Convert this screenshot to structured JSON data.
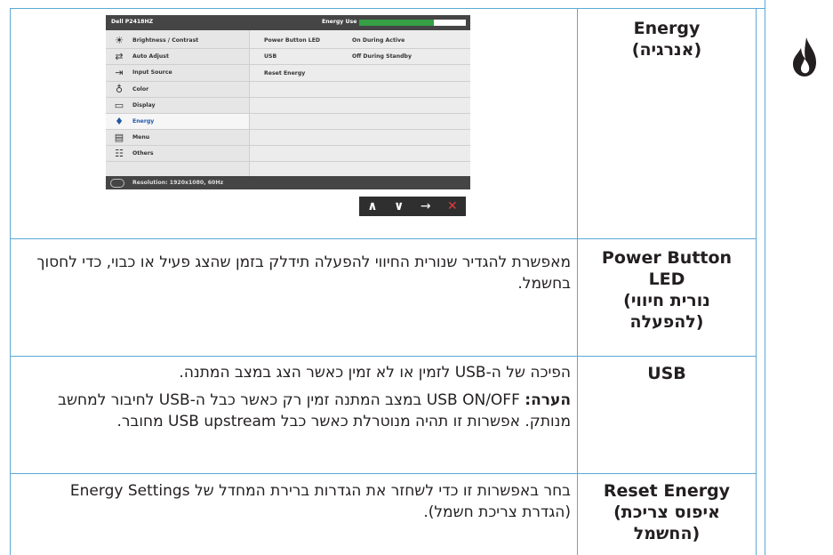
{
  "osd": {
    "model": "Dell P2418HZ",
    "energy_use_label": "Energy Use",
    "energy_use_level": 0.7,
    "menu": [
      {
        "label": "Brightness / Contrast",
        "icon": "brightness-icon"
      },
      {
        "label": "Auto Adjust",
        "icon": "auto-adjust-icon"
      },
      {
        "label": "Input Source",
        "icon": "input-source-icon"
      },
      {
        "label": "Color",
        "icon": "color-icon"
      },
      {
        "label": "Display",
        "icon": "display-icon"
      },
      {
        "label": "Energy",
        "icon": "energy-icon"
      },
      {
        "label": "Menu",
        "icon": "menu-icon"
      },
      {
        "label": "Others",
        "icon": "others-icon"
      }
    ],
    "settings": [
      {
        "name": "Power Button LED",
        "value": "On During Active"
      },
      {
        "name": "USB",
        "value": "Off During Standby"
      },
      {
        "name": "Reset Energy",
        "value": ""
      }
    ],
    "resolution": "Resolution: 1920x1080, 60Hz",
    "buttons": [
      "∧",
      "∨",
      "→",
      "✕"
    ]
  },
  "rows": [
    {
      "title": "Energy\n(אנרגיה)"
    },
    {
      "title": "Power Button\nLED\n(נורית חיווי\nלהפעלה)",
      "desc": [
        "מאפשרת להגדיר שנורית החיווי להפעלה תידלק בזמן שהצג פעיל או כבוי, כדי לחסוך בחשמל."
      ]
    },
    {
      "title": "USB",
      "desc_line1": "הפיכה של ה-USB לזמין או לא זמין כאשר הצג במצב המתנה.",
      "note_label": "הערה:",
      "note_text": " USB ON/OFF במצב המתנה זמין רק כאשר כבל ה-USB לחיבור למחשב מנותק. אפשרות זו תהיה מנוטרלת כאשר כבל USB upstream מחובר."
    },
    {
      "title": "Reset Energy\n(איפוס צריכת\nהחשמל)",
      "desc": [
        "בחר באפשרות זו כדי לשחזר את הגדרות ברירת המחדל של Energy Settings (הגדרת צריכת חשמל)."
      ]
    }
  ]
}
